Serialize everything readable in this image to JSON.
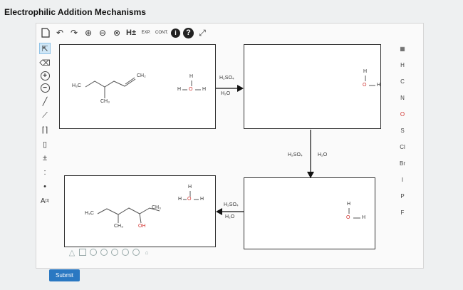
{
  "page_title": "Electrophilic Addition Mechanisms",
  "toolbar": {
    "exp_label": "EXP.",
    "cont_label": "CONT."
  },
  "left_tools": {
    "select": "⇱",
    "eraser": "⌫",
    "plus": "+",
    "minus": "−",
    "charge_label": "A",
    "charge_sup": "[1]"
  },
  "elements": [
    "H",
    "C",
    "N",
    "O",
    "S",
    "Cl",
    "Br",
    "I",
    "P",
    "F"
  ],
  "panels": {
    "top_left": {
      "h3c": "H₃C",
      "ch2": "CH₂",
      "ch3": "CH₃",
      "water_h_top": "H",
      "water_h_left": "H",
      "water_o": "O",
      "water_h_right": "H"
    },
    "top_right": {
      "h_top": "H",
      "o": "O",
      "h_right": "H"
    },
    "bottom_left": {
      "h3c": "H₃C",
      "ch3_branch": "CH₃",
      "ch3_right": "CH₃",
      "oh": "OH",
      "water_h_top": "H",
      "water_h_left": "H",
      "water_o": "O",
      "water_h_right": "H"
    },
    "bottom_right": {
      "h_top": "H",
      "o": "O",
      "h_right": "H"
    }
  },
  "reagents": {
    "top_arrow": [
      "H₂SO₄",
      "H₂O"
    ],
    "down_arrow": [
      "H₂SO₄",
      "H₂O"
    ],
    "left_arrow": [
      "H₂SO₄",
      "H₂O"
    ]
  },
  "submit_label": "Submit"
}
